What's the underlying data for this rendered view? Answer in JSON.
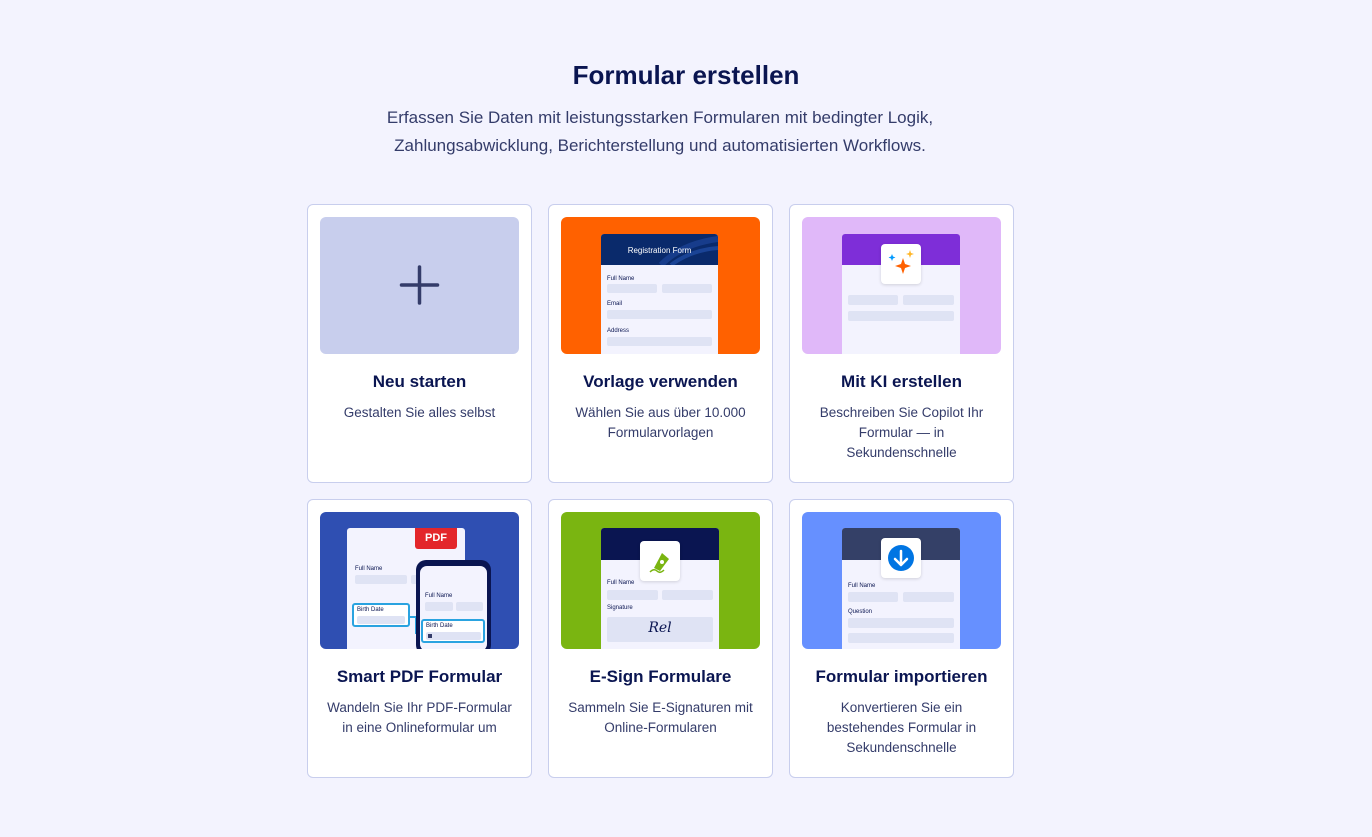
{
  "header": {
    "title": "Formular erstellen",
    "subtitle": "Erfassen Sie Daten mit leistungsstarken Formularen mit bedingter Logik, Zahlungsabwicklung, Berichterstellung und automatisierten Workflows."
  },
  "cards": [
    {
      "title": "Neu starten",
      "desc": "Gestalten Sie alles selbst",
      "icon": "plus-icon",
      "color": "#c8ceed"
    },
    {
      "title": "Vorlage verwenden",
      "desc": "Wählen Sie aus über 10.000 Formularvorlagen",
      "icon": "template-icon",
      "color": "#ff6100"
    },
    {
      "title": "Mit KI erstellen",
      "desc": "Beschreiben Sie Copilot Ihr Formular — in Sekundenschnelle",
      "icon": "sparkles-icon",
      "color": "#e0b8f9"
    },
    {
      "title": "Smart PDF Formular",
      "desc": "Wandeln Sie Ihr PDF-Formular in eine Onlineformular um",
      "icon": "pdf-icon",
      "color": "#2f4fb2"
    },
    {
      "title": "E-Sign Formulare",
      "desc": "Sammeln Sie E-Signaturen mit Online-Formularen",
      "icon": "signature-pen-icon",
      "color": "#7ab511"
    },
    {
      "title": "Formular importieren",
      "desc": "Konvertieren Sie ein bestehendes Formular in Sekundenschnelle",
      "icon": "download-icon",
      "color": "#6690ff"
    }
  ],
  "thumbs": {
    "template": {
      "form_title": "Registration Form",
      "full_name": "Full Name",
      "email": "Email",
      "address": "Address"
    },
    "pdf": {
      "badge": "PDF",
      "full_name": "Full Name",
      "birth_date": "Birth Date",
      "phone_full_name": "Full Name",
      "phone_birth_date": "Birth Date"
    },
    "esign": {
      "full_name": "Full Name",
      "signature": "Signature",
      "sig_text": "Rel"
    },
    "import": {
      "full_name": "Full Name",
      "question": "Question"
    }
  }
}
